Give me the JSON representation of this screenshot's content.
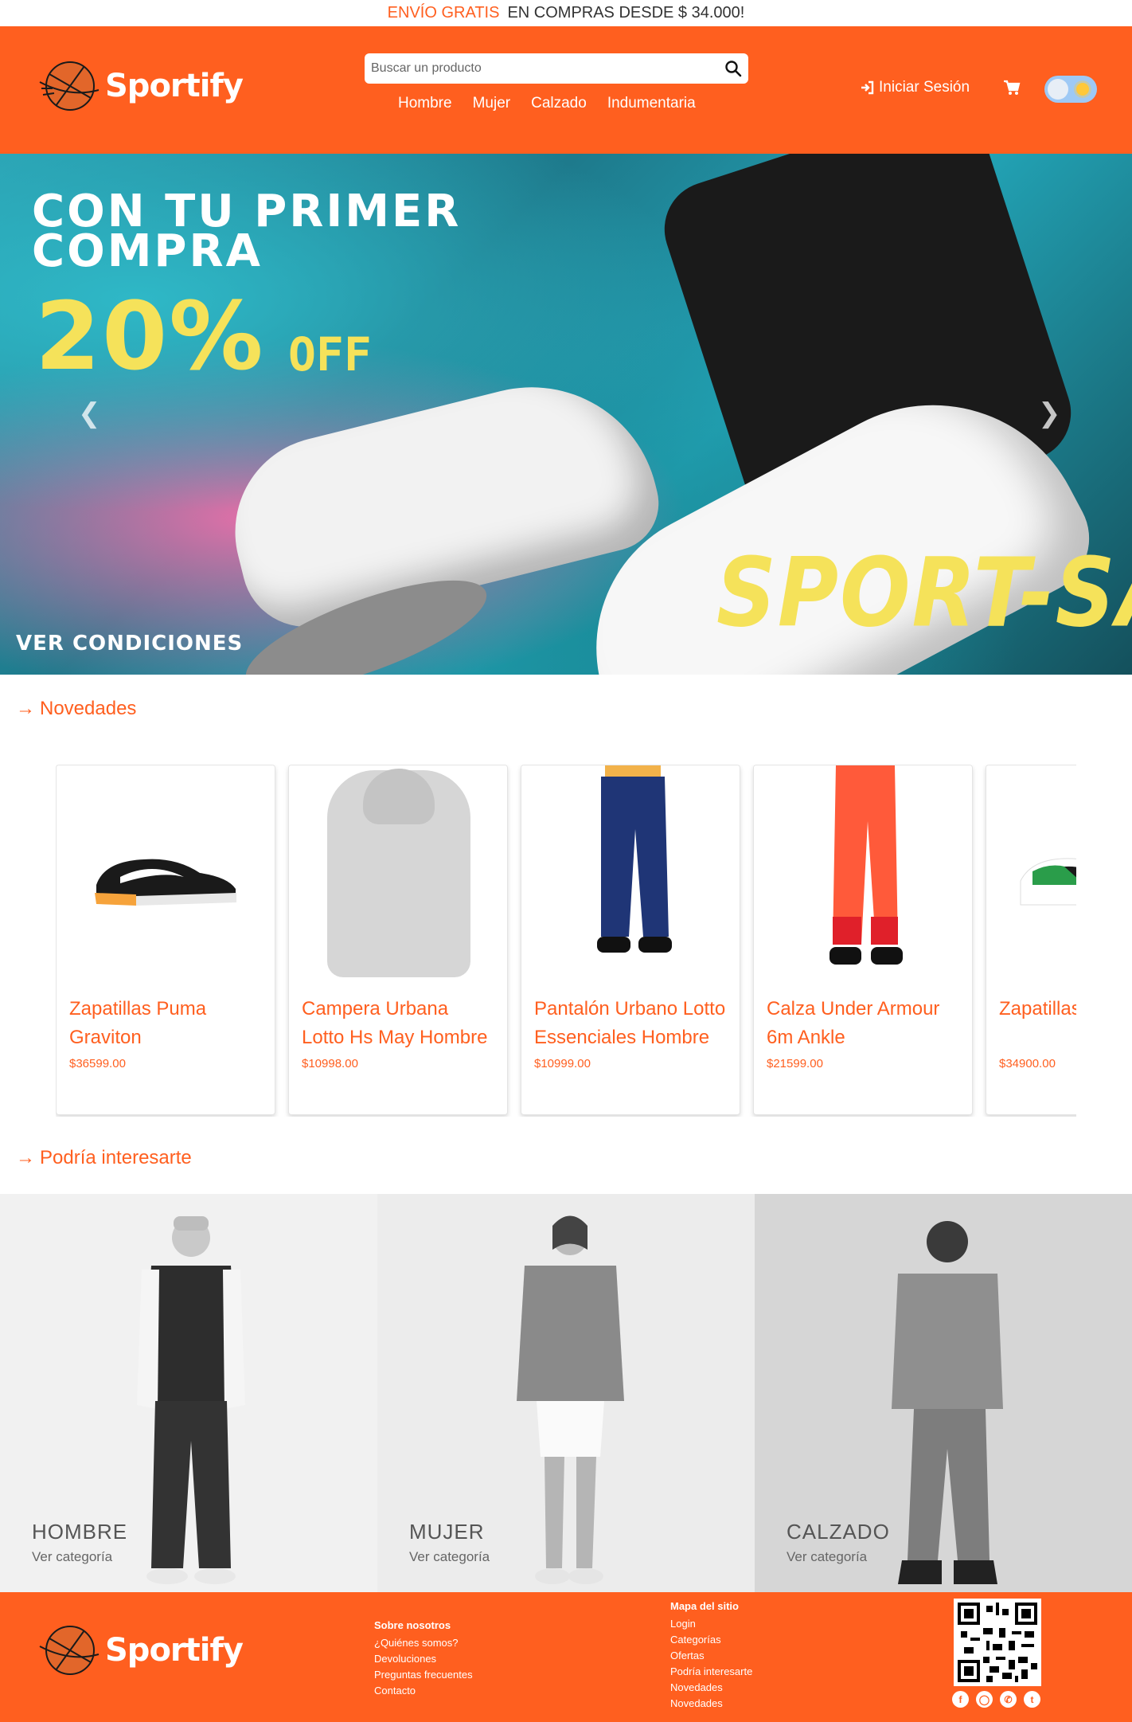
{
  "promo": {
    "accent": "ENVÍO GRATIS",
    "text": "EN COMPRAS DESDE $ 34.000!"
  },
  "header": {
    "brand": "Sportify",
    "search_placeholder": "Buscar un producto",
    "nav": [
      "Hombre",
      "Mujer",
      "Calzado",
      "Indumentaria"
    ],
    "login_label": "Iniciar Sesión",
    "theme_toggle": "light"
  },
  "hero": {
    "line1": "CON TU PRIMER",
    "line2": "COMPRA",
    "percent": "20%",
    "off": "OFF",
    "sport_sale": "SPORT-SALE",
    "conditions": "VER CONDICIONES"
  },
  "sections": {
    "novedades": "Novedades",
    "interes": "Podría interesarte",
    "arrow": "→"
  },
  "products": [
    {
      "name": "Zapatillas Puma Graviton",
      "price": "$36599.00"
    },
    {
      "name": "Campera Urbana Lotto Hs May Hombre",
      "price": "$10998.00"
    },
    {
      "name": "Pantalón Urbano Lotto Essenciales Hombre",
      "price": "$10999.00"
    },
    {
      "name": "Calza Under Armour 6m Ankle",
      "price": "$21599.00"
    },
    {
      "name": "Zapatillas Rebound",
      "price": "$34900.00"
    }
  ],
  "categories": [
    {
      "label": "HOMBRE",
      "sub": "Ver categoría"
    },
    {
      "label": "MUJER",
      "sub": "Ver categoría"
    },
    {
      "label": "CALZADO",
      "sub": "Ver categoría"
    }
  ],
  "footer": {
    "brand": "Sportify",
    "col1_title": "Sobre nosotros",
    "col1": [
      "¿Quiénes somos?",
      "Devoluciones",
      "Preguntas frecuentes",
      "Contacto"
    ],
    "col2_title": "Mapa del sitio",
    "col2": [
      "Login",
      "Categorías",
      "Ofertas",
      "Podría interesarte",
      "Novedades",
      "Novedades"
    ],
    "social": [
      "facebook-icon",
      "instagram-icon",
      "whatsapp-icon",
      "twitter-icon"
    ]
  },
  "colors": {
    "brand": "#ff5f1f",
    "sale_yellow": "#f5e25a"
  }
}
